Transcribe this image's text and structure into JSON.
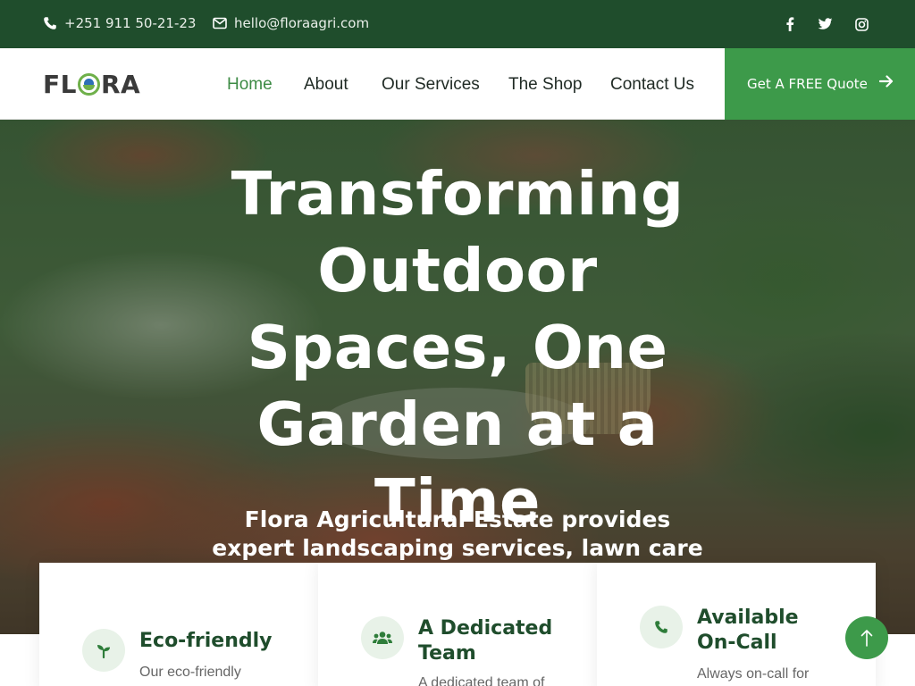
{
  "topbar": {
    "phone": "+251 911 50-21-23",
    "email": "hello@floraagri.com",
    "social": [
      "facebook-icon",
      "twitter-icon",
      "instagram-icon"
    ]
  },
  "nav": {
    "logo_text_left": "FL",
    "logo_text_right": "RA",
    "items": [
      {
        "label": "Home",
        "active": true
      },
      {
        "label": "About"
      },
      {
        "label": "Our Services"
      },
      {
        "label": "The Shop"
      },
      {
        "label": "Contact Us"
      }
    ],
    "cta_label": "Get A FREE Quote"
  },
  "hero": {
    "title": "Transforming Outdoor Spaces, One Garden at a Time",
    "subtitle": "Flora Agricultural Estate provides expert landscaping services, lawn care services,"
  },
  "features": [
    {
      "icon": "seedling-icon",
      "title": "Eco-friendly",
      "text": "Our eco-friendly"
    },
    {
      "icon": "users-icon",
      "title": "A Dedicated Team",
      "text": "A dedicated team of"
    },
    {
      "icon": "phone-icon",
      "title": "Available On-Call",
      "text": "Always on-call for"
    }
  ],
  "colors": {
    "topbar_bg": "#1f4d2c",
    "accent": "#3d9a4a",
    "active_nav": "#3d8b45",
    "feature_title": "#1f4d2c"
  }
}
